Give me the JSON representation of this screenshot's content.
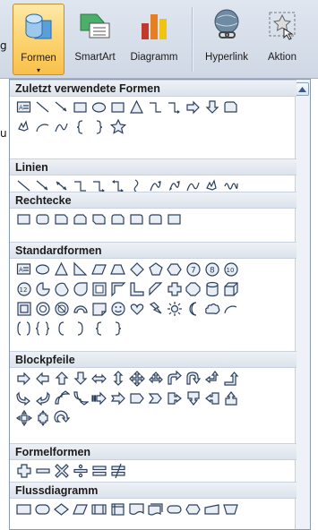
{
  "ribbon": {
    "left_fragment": "g",
    "buttons": [
      {
        "label": "Formen",
        "icon": "shapes-icon",
        "active": true
      },
      {
        "label": "SmartArt",
        "icon": "smartart-icon"
      },
      {
        "label": "Diagramm",
        "icon": "chart-icon"
      },
      {
        "label": "Hyperlink",
        "icon": "hyperlink-icon"
      },
      {
        "label": "Aktion",
        "icon": "action-icon"
      }
    ],
    "dropdown_arrow": "▾"
  },
  "left_text_fragment": "u",
  "gallery": {
    "sections": [
      {
        "title": "Zuletzt verwendete Formen",
        "rows": [
          [
            "textbox",
            "line",
            "arrow-line",
            "rect",
            "oval",
            "rect",
            "triangle",
            "elbow",
            "elbow-arrow",
            "arrow-right",
            "arrow-down",
            "snip"
          ],
          [
            "freeform",
            "arc",
            "curve",
            "brace-left",
            "brace-right",
            "star"
          ]
        ]
      },
      {
        "title": "Linien",
        "rows": [
          [
            "line",
            "arrow-line",
            "dbl-arrow-line",
            "elbow",
            "elbow-arrow",
            "elbow-dbl",
            "curve-s",
            "curve-arrow",
            "curve-dbl",
            "curve",
            "freeform",
            "scribble"
          ]
        ]
      },
      {
        "title": "Rechtecke",
        "rows": [
          [
            "rect",
            "round-rect",
            "snip-rect",
            "snip2-rect",
            "snip3-rect",
            "round-snip",
            "round-rect2",
            "round-rect3",
            "rect"
          ]
        ]
      },
      {
        "title": "Standardformen",
        "rows": [
          [
            "textbox",
            "oval",
            "triangle",
            "right-triangle",
            "parallelogram",
            "trapezoid",
            "diamond",
            "pentagon",
            "hexagon",
            "num7",
            "num8",
            "num10"
          ],
          [
            "num12",
            "pie",
            "chord",
            "teardrop",
            "frame",
            "half-frame",
            "l-shape",
            "diag-stripe",
            "cross",
            "octagon",
            "can",
            "cube"
          ],
          [
            "bevel",
            "donut",
            "no-symbol",
            "block-arc",
            "fold",
            "smiley",
            "heart",
            "lightning",
            "sun",
            "moon",
            "cloud",
            "arc"
          ],
          [
            "bracket-pair",
            "brace-pair",
            "bracket-left",
            "bracket-right",
            "brace-left",
            "brace-right"
          ]
        ]
      },
      {
        "title": "Blockpfeile",
        "rows": [
          [
            "arrow-right",
            "arrow-left",
            "arrow-up",
            "arrow-down",
            "arrow-lr",
            "arrow-ud",
            "quad-arrow",
            "lru-arrow",
            "bent-arrow",
            "u-turn",
            "left-up",
            "bent-up"
          ],
          [
            "curved-right",
            "curved-left",
            "curved-up",
            "curved-down",
            "striped-right",
            "notched-right",
            "pentagon-arrow",
            "chevron",
            "callout-right",
            "callout-down",
            "callout-left",
            "callout-up"
          ],
          [
            "callout-quad",
            "quad-callout",
            "circular-arrow"
          ]
        ]
      },
      {
        "title": "Formelformen",
        "rows": [
          [
            "plus",
            "minus",
            "multiply",
            "divide",
            "equal",
            "not-equal"
          ]
        ]
      },
      {
        "title": "Flussdiagramm",
        "rows": [
          [
            "process",
            "terminator",
            "decision",
            "data",
            "predefined",
            "internal",
            "document",
            "multidoc",
            "terminator2",
            "prep",
            "manual-input",
            "manual-op"
          ]
        ]
      }
    ]
  }
}
